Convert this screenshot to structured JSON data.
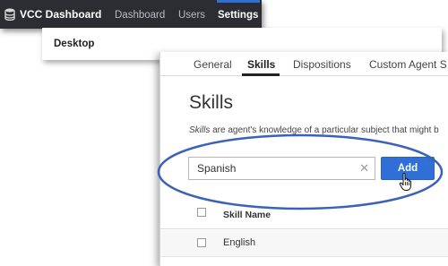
{
  "topbar": {
    "app_title": "VCC Dashboard",
    "nav": [
      "Dashboard",
      "Users",
      "Settings"
    ],
    "active": "Settings"
  },
  "subbar": {
    "label": "Desktop"
  },
  "tabs": [
    "General",
    "Skills",
    "Dispositions",
    "Custom Agent S"
  ],
  "active_tab": "Skills",
  "page": {
    "title": "Skills",
    "description_em": "Skills",
    "description_rest": " are agent's knowledge of a particular subject that might b"
  },
  "search": {
    "value": "Spanish"
  },
  "add_button": {
    "label": "Add"
  },
  "table": {
    "columns": [
      "Skill Name"
    ],
    "rows": [
      {
        "name": "English"
      }
    ]
  },
  "colors": {
    "topbar_bg": "#2b2d33",
    "accent": "#2f6fd6",
    "highlight_ellipse": "#3a63b8"
  }
}
